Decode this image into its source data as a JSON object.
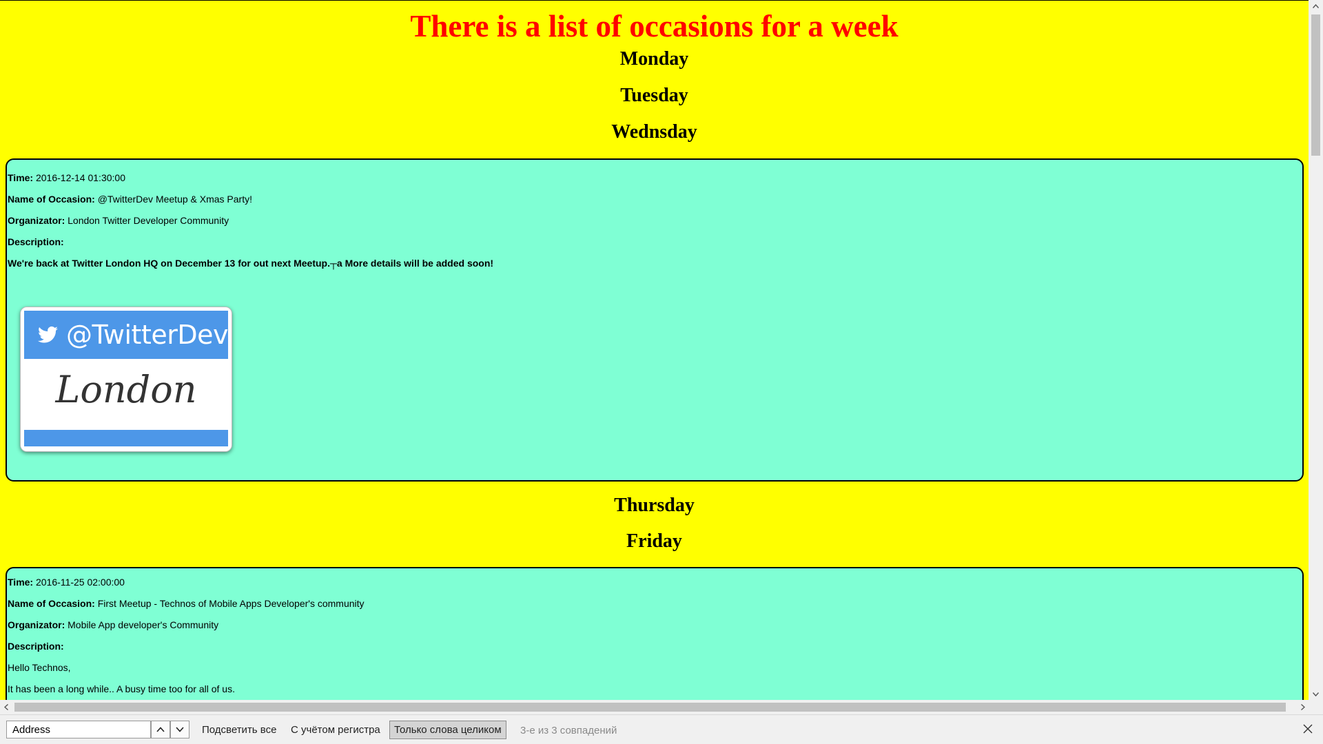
{
  "page": {
    "title": "There is a list of occasions for a week",
    "days": [
      "Monday",
      "Tuesday",
      "Wednsday",
      "Thursday",
      "Friday"
    ]
  },
  "events": [
    {
      "time_label": "Time:",
      "time": "2016-12-14 01:30:00",
      "name_label": "Name of Occasion:",
      "name": "@TwitterDev Meetup & Xmas Party!",
      "organizer_label": "Organizator:",
      "organizer": "London Twitter Developer Community",
      "description_label": "Description:",
      "description": "We're back at Twitter London HQ on December 13 for out next Meetup.┬a More details will be added soon!",
      "image": {
        "handle": "@TwitterDev",
        "city": "London",
        "brand_color": "#4d97e8"
      }
    },
    {
      "time_label": "Time:",
      "time": "2016-11-25 02:00:00",
      "name_label": "Name of Occasion:",
      "name": "First Meetup - Technos of Mobile Apps Developer's community",
      "organizer_label": "Organizator:",
      "organizer": "Mobile App developer's Community",
      "description_label": "Description:",
      "description_lines": [
        "Hello Technos,",
        "It has been a long while.. A busy time too for all of us."
      ]
    }
  ],
  "colors": {
    "page_background": "#ffff00",
    "title_color": "#ff0000",
    "card_background": "#7fffd4"
  },
  "findbar": {
    "search_value": "Address",
    "highlight_all": "Подсветить все",
    "match_case": "С учётом регистра",
    "whole_words": "Только слова целиком",
    "status": "3-е из 3 совпадений"
  }
}
